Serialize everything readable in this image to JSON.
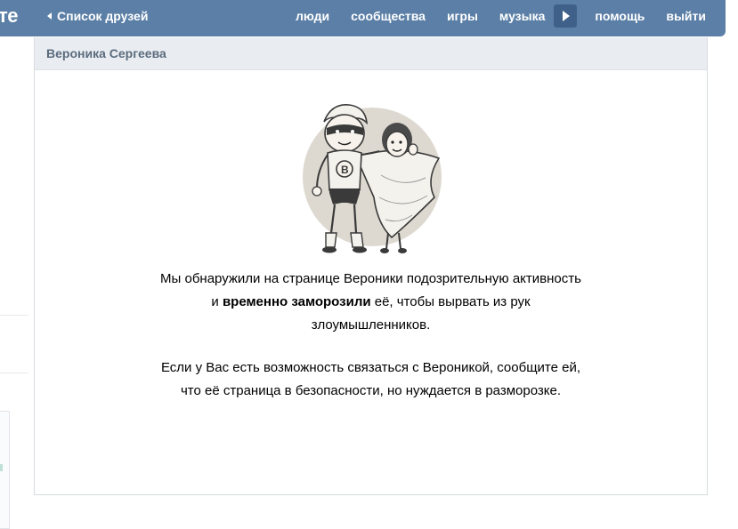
{
  "header": {
    "logo_fragment": "те",
    "back_link": "Список друзей",
    "nav": [
      "люди",
      "сообщества",
      "игры",
      "музыка",
      "помощь",
      "выйти"
    ],
    "play_icon": "play-icon",
    "bg_color": "#5b7fa6"
  },
  "panel": {
    "title": "Вероника Сергеева",
    "illustration_icon": "superhero-couple-icon",
    "paragraph1": {
      "line1": "Мы обнаружили на странице Вероники подозрительную активность",
      "line2_prefix": "и ",
      "line2_bold": "временно заморозили",
      "line2_suffix": " её, чтобы вырвать из рук",
      "line3": "злоумышленников."
    },
    "paragraph2": {
      "line1": "Если у Вас есть возможность связаться с Вероникой, сообщите ей,",
      "line2": "что её страница в безопасности, но нуждается в разморозке."
    }
  }
}
